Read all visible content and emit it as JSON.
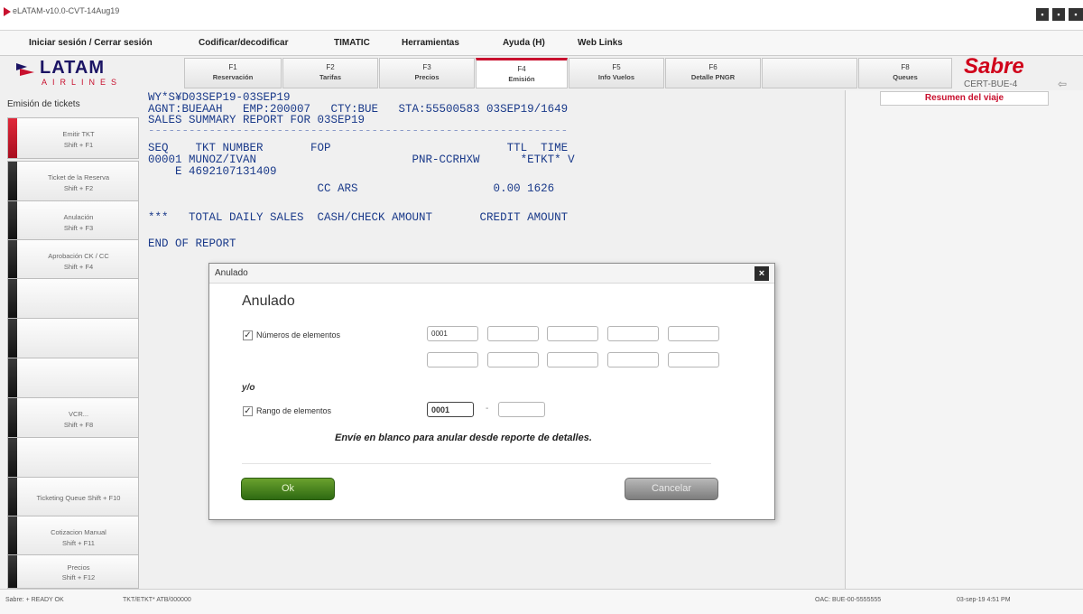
{
  "window": {
    "title": "eLATAM-v10.0-CVT-14Aug19",
    "buttons": [
      "▪",
      "▪",
      "▪"
    ]
  },
  "menu": [
    "Iniciar sesión / Cerrar sesión",
    "Codificar/decodificar",
    "TIMATIC",
    "Herramientas",
    "Ayuda (H)",
    "Web Links"
  ],
  "logo": {
    "brand": "LATAM",
    "sub": "AIRLINES",
    "colors": {
      "navy": "#1b1464",
      "red": "#c8102e"
    }
  },
  "ftabs": [
    {
      "key": "F1",
      "label": "Reservación",
      "active": false
    },
    {
      "key": "F2",
      "label": "Tarifas",
      "active": false
    },
    {
      "key": "F3",
      "label": "Precios",
      "active": false
    },
    {
      "key": "F4",
      "label": "Emisión",
      "active": true
    },
    {
      "key": "F5",
      "label": "Info Vuelos",
      "active": false
    },
    {
      "key": "F6",
      "label": "Detalle PNGR",
      "active": false
    },
    {
      "key": "",
      "label": "",
      "active": false
    },
    {
      "key": "F8",
      "label": "Queues",
      "active": false
    }
  ],
  "sabre": {
    "brand": "Sabre",
    "cert": "CERT-BUE-4",
    "icon": "share-icon"
  },
  "sidebar": {
    "title": "Emisión de tickets",
    "buttons": [
      {
        "l1": "Emitir TKT",
        "l2": "Shift + F1",
        "active": true
      },
      {
        "l1": "Ticket de la Reserva",
        "l2": "Shift + F2",
        "active": false
      },
      {
        "l1": "Anulación",
        "l2": "Shift + F3",
        "active": false
      },
      {
        "l1": "Aprobación CK / CC",
        "l2": "Shift + F4",
        "active": false
      },
      {
        "l1": "",
        "l2": "",
        "active": false
      },
      {
        "l1": "",
        "l2": "",
        "active": false
      },
      {
        "l1": "",
        "l2": "",
        "active": false
      },
      {
        "l1": "VCR...",
        "l2": "Shift + F8",
        "active": false
      },
      {
        "l1": "",
        "l2": "",
        "active": false
      },
      {
        "l1": "Ticketing Queue Shift + F10",
        "l2": "",
        "active": false
      },
      {
        "l1": "Cotizacion Manual",
        "l2": "Shift + F11",
        "active": false
      },
      {
        "l1": "Precios",
        "l2": "Shift + F12",
        "active": false
      }
    ]
  },
  "terminal": {
    "lines": [
      "WY*S¥D03SEP19-03SEP19",
      "AGNT:BUEAAH   EMP:200007   CTY:BUE   STA:55500583 03SEP19/1649",
      "SALES SUMMARY REPORT FOR 03SEP19",
      "--------------------------------------------------------------",
      "SEQ    TKT NUMBER       FOP                          TTL  TIME",
      "00001 MUNOZ/IVAN                       PNR-CCRHXW      *ETKT* V",
      "    E 4692107131409",
      "                         CC ARS                    0.00 1626",
      "",
      "***   TOTAL DAILY SALES  CASH/CHECK AMOUNT       CREDIT AMOUNT",
      "",
      "END OF REPORT"
    ]
  },
  "rightpanel": {
    "tab": "Resumen del viaje"
  },
  "dialog": {
    "title": "Anulado",
    "heading": "Anulado",
    "numeros_label": "Números de elementos",
    "numeros_values": [
      "0001",
      "",
      "",
      "",
      "",
      "",
      "",
      "",
      "",
      ""
    ],
    "yo": "y/o",
    "rango_label": "Rango de elementos",
    "rango_from": "0001",
    "rango_to": "",
    "hint": "Envíe en blanco para anular desde reporte de detalles.",
    "ok": "Ok",
    "cancel": "Cancelar"
  },
  "status": {
    "left": "Sabre: + READY OK",
    "mid": "TKT/ETKT* ATB/000000",
    "right1": "OAC: BUE-00-5555555",
    "right2": "03-sep-19 4:51 PM"
  }
}
